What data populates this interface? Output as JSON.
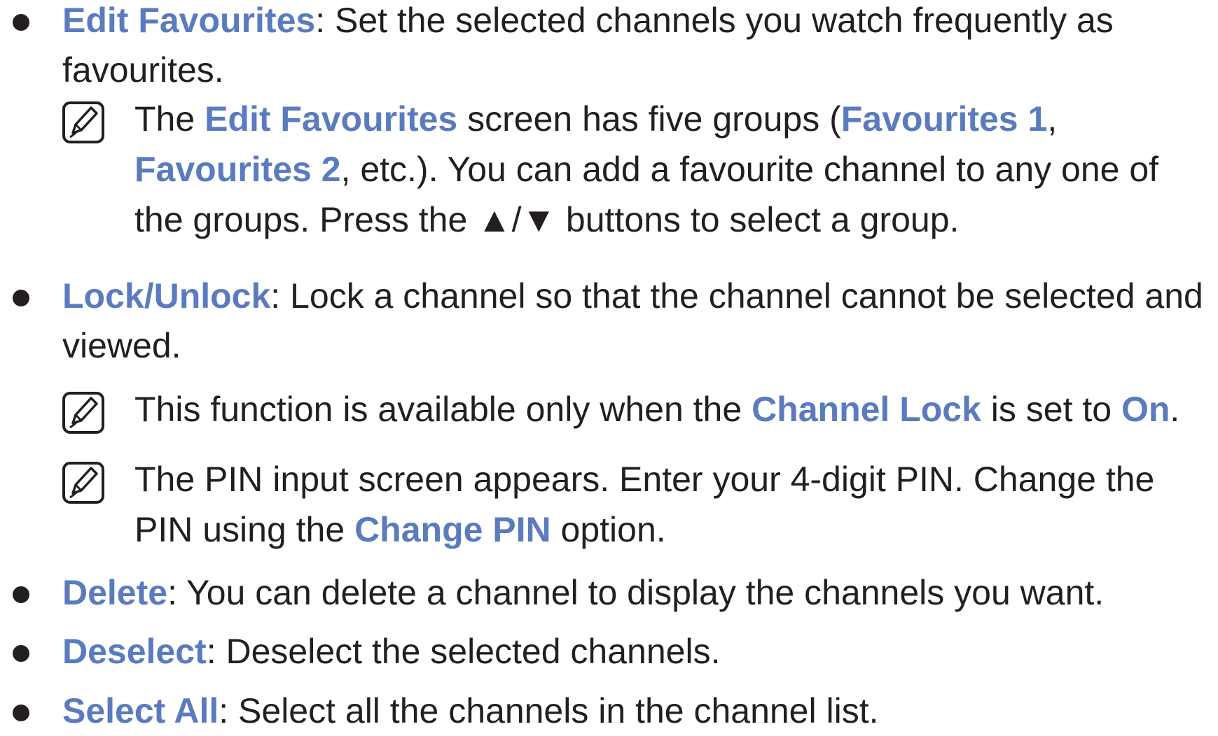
{
  "items": [
    {
      "term": "Edit Favourites",
      "text": ": Set the selected channels you watch frequently as favourites.",
      "notes": [
        {
          "parts": [
            {
              "t": "The ",
              "k": false
            },
            {
              "t": "Edit Favourites",
              "k": true
            },
            {
              "t": " screen has five groups (",
              "k": false
            },
            {
              "t": "Favourites 1",
              "k": true
            },
            {
              "t": ", ",
              "k": false
            },
            {
              "t": "Favourites 2",
              "k": true
            },
            {
              "t": ", etc.). You can add a favourite channel to any one of the groups. Press the ▲/▼ buttons to select a group.",
              "k": false
            }
          ]
        }
      ]
    },
    {
      "term": "Lock/Unlock",
      "text": ": Lock a channel so that the channel cannot be selected and viewed.",
      "notes": [
        {
          "parts": [
            {
              "t": "This function is available only when the ",
              "k": false
            },
            {
              "t": "Channel Lock",
              "k": true
            },
            {
              "t": " is set to ",
              "k": false
            },
            {
              "t": "On",
              "k": true
            },
            {
              "t": ".",
              "k": false
            }
          ]
        },
        {
          "parts": [
            {
              "t": "The PIN input screen appears. Enter your 4-digit PIN. Change the PIN using the ",
              "k": false
            },
            {
              "t": "Change PIN",
              "k": true
            },
            {
              "t": " option.",
              "k": false
            }
          ]
        }
      ]
    },
    {
      "term": "Delete",
      "text": ": You can delete a channel to display the channels you want.",
      "notes": []
    },
    {
      "term": "Deselect",
      "text": ": Deselect the selected channels.",
      "notes": []
    },
    {
      "term": "Select All",
      "text": ": Select all the channels in the channel list.",
      "notes": []
    }
  ],
  "colors": {
    "keyword": "#5a7bbf",
    "text": "#231f20"
  },
  "icons": {
    "note": "note-pencil-icon"
  }
}
